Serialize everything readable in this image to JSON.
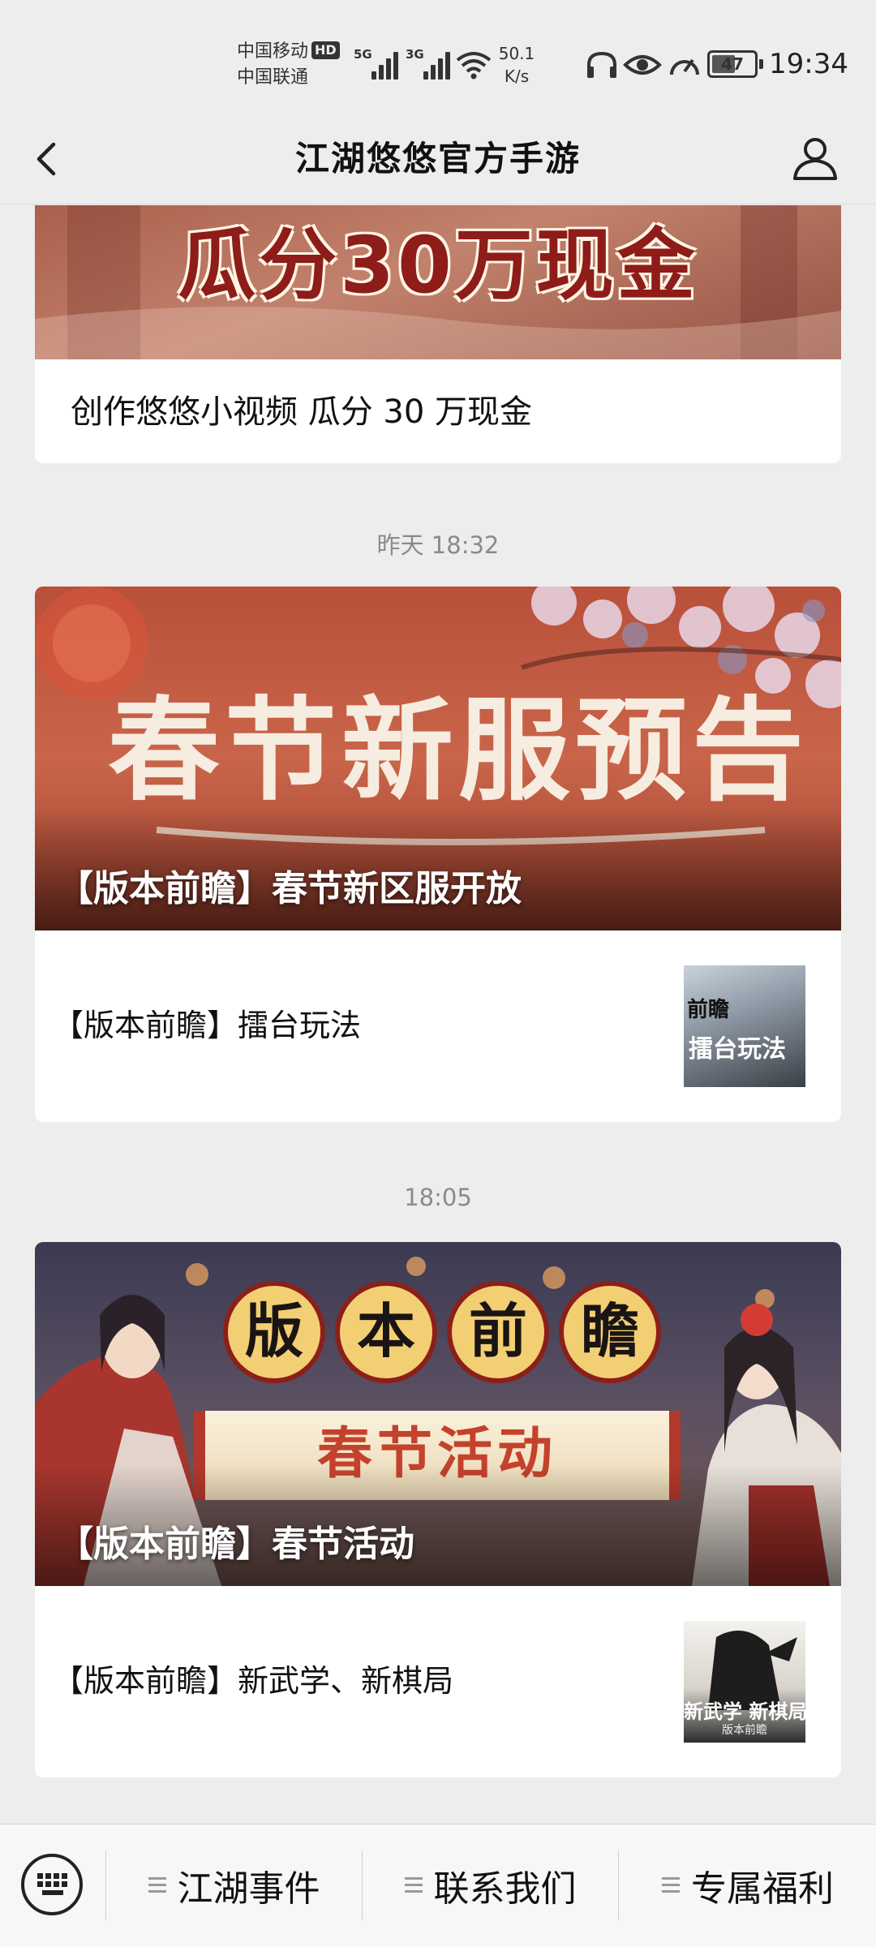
{
  "status_bar": {
    "carrier1": "中国移动",
    "carrier2": "中国联通",
    "hd": "HD",
    "net1": "5G",
    "net2": "3G",
    "speed_value": "50.1",
    "speed_unit": "K/s",
    "battery": "47",
    "time": "19:34"
  },
  "header": {
    "title": "江湖悠悠官方手游"
  },
  "feed": {
    "card1": {
      "banner_text": "瓜分30万现金",
      "title": "创作悠悠小视频 瓜分 30 万现金"
    },
    "timestamp2": "昨天 18:32",
    "card2": {
      "banner_text": "春节新服预告",
      "main_title": "【版本前瞻】春节新区服开放",
      "sub_title": "【版本前瞻】擂台玩法",
      "thumb_text1": "前瞻",
      "thumb_text2": "擂台玩法"
    },
    "timestamp3": "18:05",
    "card3": {
      "banner_chars": [
        "版",
        "本",
        "前",
        "瞻"
      ],
      "banner_scroll": "春节活动",
      "main_title": "【版本前瞻】春节活动",
      "sub_title": "【版本前瞻】新武学、新棋局",
      "thumb_text1": "新武学 新棋局",
      "thumb_text2": "版本前瞻"
    }
  },
  "bottom_nav": {
    "items": [
      "江湖事件",
      "联系我们",
      "专属福利"
    ]
  }
}
